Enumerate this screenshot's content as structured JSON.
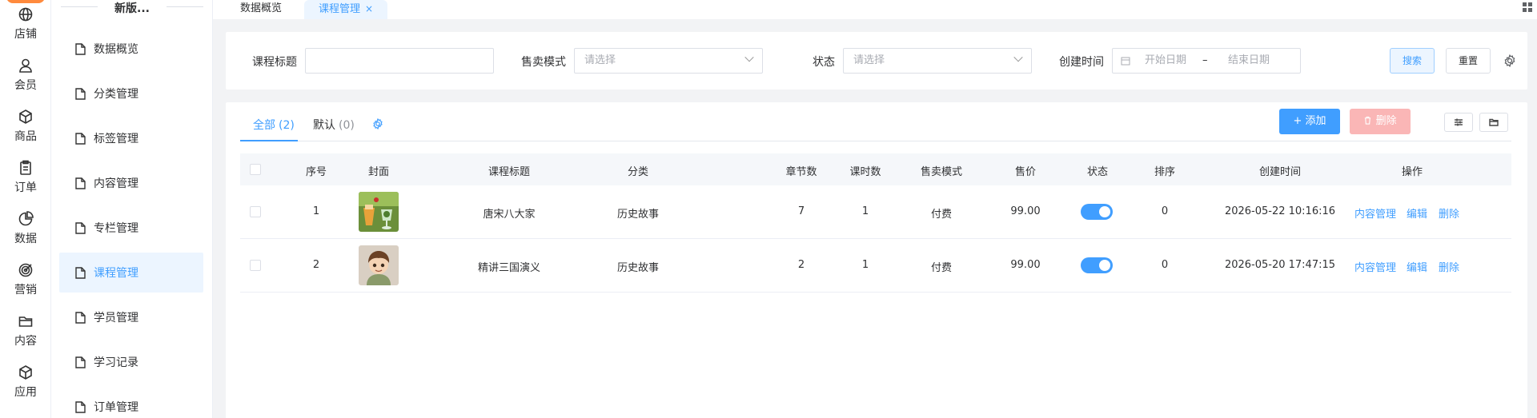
{
  "rail": {
    "items": [
      {
        "label": "店铺",
        "icon": "store-icon"
      },
      {
        "label": "会员",
        "icon": "member-icon"
      },
      {
        "label": "商品",
        "icon": "product-icon"
      },
      {
        "label": "订单",
        "icon": "order-icon"
      },
      {
        "label": "数据",
        "icon": "data-icon"
      },
      {
        "label": "营销",
        "icon": "marketing-icon"
      },
      {
        "label": "内容",
        "icon": "content-icon"
      },
      {
        "label": "应用",
        "icon": "app-icon"
      }
    ]
  },
  "sidebar": {
    "title": "新版...",
    "items": [
      {
        "label": "数据概览"
      },
      {
        "label": "分类管理"
      },
      {
        "label": "标签管理"
      },
      {
        "label": "内容管理"
      },
      {
        "label": "专栏管理"
      },
      {
        "label": "课程管理",
        "active": true
      },
      {
        "label": "学员管理"
      },
      {
        "label": "学习记录"
      },
      {
        "label": "订单管理"
      }
    ]
  },
  "tabs": [
    {
      "label": "数据概览"
    },
    {
      "label": "课程管理",
      "close": "×",
      "active": true
    }
  ],
  "filter": {
    "title_label": "课程标题",
    "title_value": "",
    "mode_label": "售卖模式",
    "mode_placeholder": "请选择",
    "status_label": "状态",
    "status_placeholder": "请选择",
    "created_label": "创建时间",
    "start_placeholder": "开始日期",
    "range_sep": "–",
    "end_placeholder": "结束日期",
    "search_label": "搜索",
    "reset_label": "重置"
  },
  "table_tabs": [
    {
      "label": "全部",
      "count": "(2)",
      "active": true
    },
    {
      "label": "默认",
      "count": "(0)"
    }
  ],
  "actions": {
    "add_label": "添加",
    "add_prefix": "+",
    "delete_label": "删除"
  },
  "table": {
    "columns": [
      "序号",
      "封面",
      "课程标题",
      "分类",
      "章节数",
      "课时数",
      "售卖模式",
      "售价",
      "状态",
      "排序",
      "创建时间",
      "操作"
    ],
    "rows": [
      {
        "index": "1",
        "title": "唐宋八大家",
        "category": "历史故事",
        "chapters": "7",
        "lessons": "1",
        "mode": "付费",
        "price": "99.00",
        "status_on": true,
        "sort": "0",
        "created": "2026-05-22 10:16:16",
        "ops": [
          "内容管理",
          "编辑",
          "删除"
        ]
      },
      {
        "index": "2",
        "title": "精讲三国演义",
        "category": "历史故事",
        "chapters": "2",
        "lessons": "1",
        "mode": "付费",
        "price": "99.00",
        "status_on": true,
        "sort": "0",
        "created": "2026-05-20 17:47:15",
        "ops": [
          "内容管理",
          "编辑",
          "删除"
        ]
      }
    ]
  },
  "colors": {
    "primary": "#409eff",
    "danger_light": "#fab6b6",
    "logo": "#ff8a3d"
  }
}
